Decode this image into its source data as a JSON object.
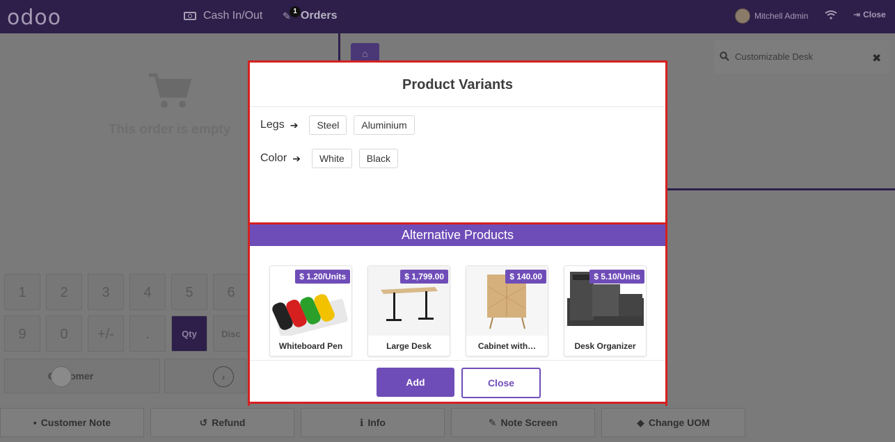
{
  "navbar": {
    "logo": "odoo",
    "cash_label": "Cash In/Out",
    "orders_label": "Orders",
    "orders_badge": "1",
    "user_name": "Mitchell Admin",
    "close_label": "Close"
  },
  "order": {
    "empty_text": "This order is empty"
  },
  "search": {
    "value": "Customizable Desk"
  },
  "numpad": {
    "row1": [
      "1",
      "2",
      "3",
      "4",
      "5",
      "6"
    ],
    "row2": [
      "9",
      "0",
      "+/-",
      ".",
      "Qty",
      "Disc"
    ],
    "customer_label": "Customer"
  },
  "footer": {
    "buttons": [
      "Customer Note",
      "Refund",
      "Info",
      "Note Screen",
      "Change UOM"
    ]
  },
  "modal": {
    "title": "Product Variants",
    "attributes": [
      {
        "label": "Legs",
        "values": [
          "Steel",
          "Aluminium"
        ]
      },
      {
        "label": "Color",
        "values": [
          "White",
          "Black"
        ]
      }
    ],
    "alt_header": "Alternative Products",
    "products": [
      {
        "name": "Whiteboard Pen",
        "price": "$ 1.20/Units"
      },
      {
        "name": "Large Desk",
        "price": "$ 1,799.00"
      },
      {
        "name": "Cabinet with…",
        "price": "$ 140.00"
      },
      {
        "name": "Desk Organizer",
        "price": "$ 5.10/Units"
      }
    ],
    "add_label": "Add",
    "close_label": "Close"
  },
  "colors": {
    "brand": "#6f4db8",
    "navbar": "#2d1f4a",
    "highlight": "#d62020"
  }
}
